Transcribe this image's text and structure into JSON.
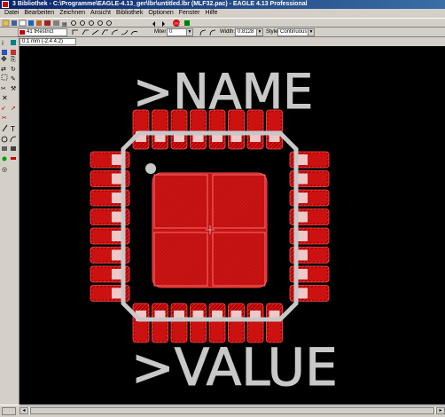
{
  "window": {
    "title": "3 Bibliothek - C:\\Programme\\EAGLE-4.13_ger\\lbr\\untitled.lbr (MLF32.pac) - EAGLE 4.13 Professional"
  },
  "menu": {
    "items": [
      "Datei",
      "Bearbeiten",
      "Zeichnen",
      "Ansicht",
      "Bibliothek",
      "Optionen",
      "Fenster",
      "Hilfe"
    ]
  },
  "toolbar": {
    "layer": "41 tRestrict",
    "miter_label": "Miter:",
    "miter_value": "0",
    "width_label": "Width:",
    "width_value": "0.8128",
    "style_label": "Style:",
    "style_value": "Continuous"
  },
  "coordinate": "0.1 mm (-2.4 4.2)",
  "canvas": {
    "name_label": ">NAME",
    "value_label": ">VALUE"
  },
  "colors": {
    "pad": "#cc1111",
    "pad_tip": "#f0c8c8",
    "restrict": "#ff3333",
    "silkscreen": "#c8c8c8",
    "background": "#000000"
  },
  "icons": {
    "stop": "stop-icon",
    "undo": "undo-icon",
    "redo": "redo-icon",
    "zoom": "zoom-icon"
  }
}
